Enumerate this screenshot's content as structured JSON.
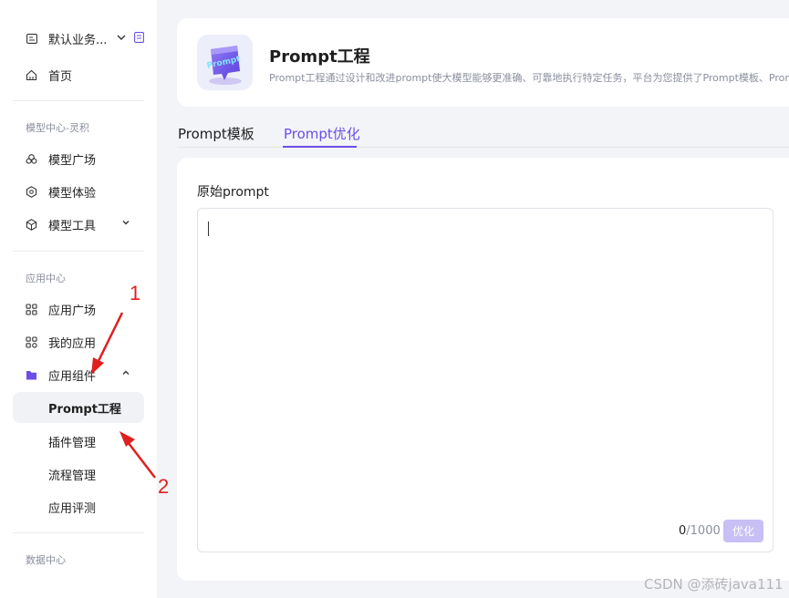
{
  "sidebar": {
    "workspace": {
      "label": "默认业务..."
    },
    "home": {
      "label": "首页"
    },
    "sections": {
      "model_center": "模型中心-灵积",
      "app_center": "应用中心",
      "data_center": "数据中心"
    },
    "model_items": [
      {
        "label": "模型广场",
        "icon": "cloud-icon"
      },
      {
        "label": "模型体验",
        "icon": "hexagon-icon"
      },
      {
        "label": "模型工具",
        "icon": "cube-icon"
      }
    ],
    "app_items": [
      {
        "label": "应用广场",
        "icon": "grid-icon"
      },
      {
        "label": "我的应用",
        "icon": "my-app-icon"
      },
      {
        "label": "应用组件",
        "icon": "folder-icon"
      }
    ],
    "component_sub": [
      {
        "label": "Prompt工程"
      },
      {
        "label": "插件管理"
      },
      {
        "label": "流程管理"
      },
      {
        "label": "应用评测"
      }
    ],
    "accent_color": "#6c4ee6"
  },
  "header": {
    "logo_text": "Prompt",
    "title": "Prompt工程",
    "description": "Prompt工程通过设计和改进prompt使大模型能够更准确、可靠地执行特定任务，平台为您提供了Prompt模板、Promp"
  },
  "tabs": [
    {
      "label": "Prompt模板"
    },
    {
      "label": "Prompt优化"
    }
  ],
  "editor": {
    "label": "原始prompt",
    "value": "",
    "count": "0",
    "max": "/1000",
    "optimize_label": "优化"
  },
  "annotations": {
    "num1": "1",
    "num2": "2",
    "color": "#e02020"
  },
  "watermark": "CSDN @添砖java111"
}
